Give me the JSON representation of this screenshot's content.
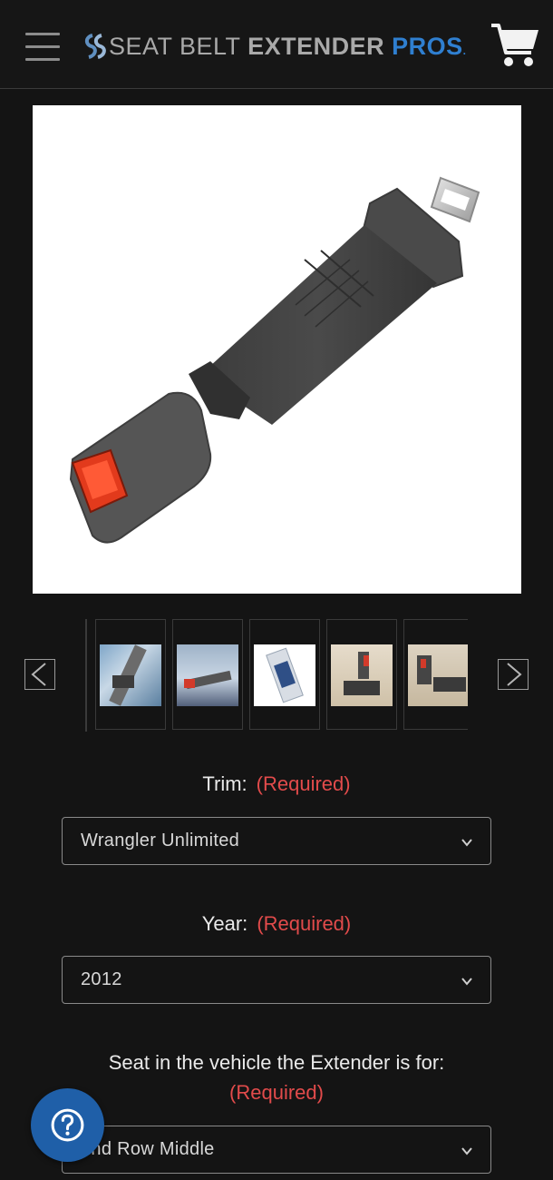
{
  "header": {
    "logo": {
      "part1": "SEAT BELT ",
      "part2": "EXTENDER ",
      "part3": "PROS",
      "registered": "."
    },
    "menu_icon": "hamburger-menu-icon",
    "cart_icon": "shopping-cart-icon"
  },
  "product": {
    "image": "seat-belt-extender-product-photo"
  },
  "thumbnails": {
    "prev_icon": "chevron-left-icon",
    "next_icon": "chevron-right-icon",
    "items": [
      "thumbnail-1",
      "thumbnail-2",
      "thumbnail-3",
      "thumbnail-4",
      "thumbnail-5"
    ]
  },
  "form": {
    "trim": {
      "label": "Trim:",
      "required": "(Required)",
      "value": "Wrangler Unlimited"
    },
    "year": {
      "label": "Year:",
      "required": "(Required)",
      "value": "2012"
    },
    "seat": {
      "label": "Seat in the vehicle the Extender is for:",
      "required": "(Required)",
      "value": "2nd Row Middle"
    }
  },
  "help": {
    "icon": "question-mark-icon"
  },
  "colors": {
    "background": "#141414",
    "brand_blue": "#2f7fd0",
    "required_red": "#e24b4b",
    "help_button": "#1f5fa8"
  }
}
